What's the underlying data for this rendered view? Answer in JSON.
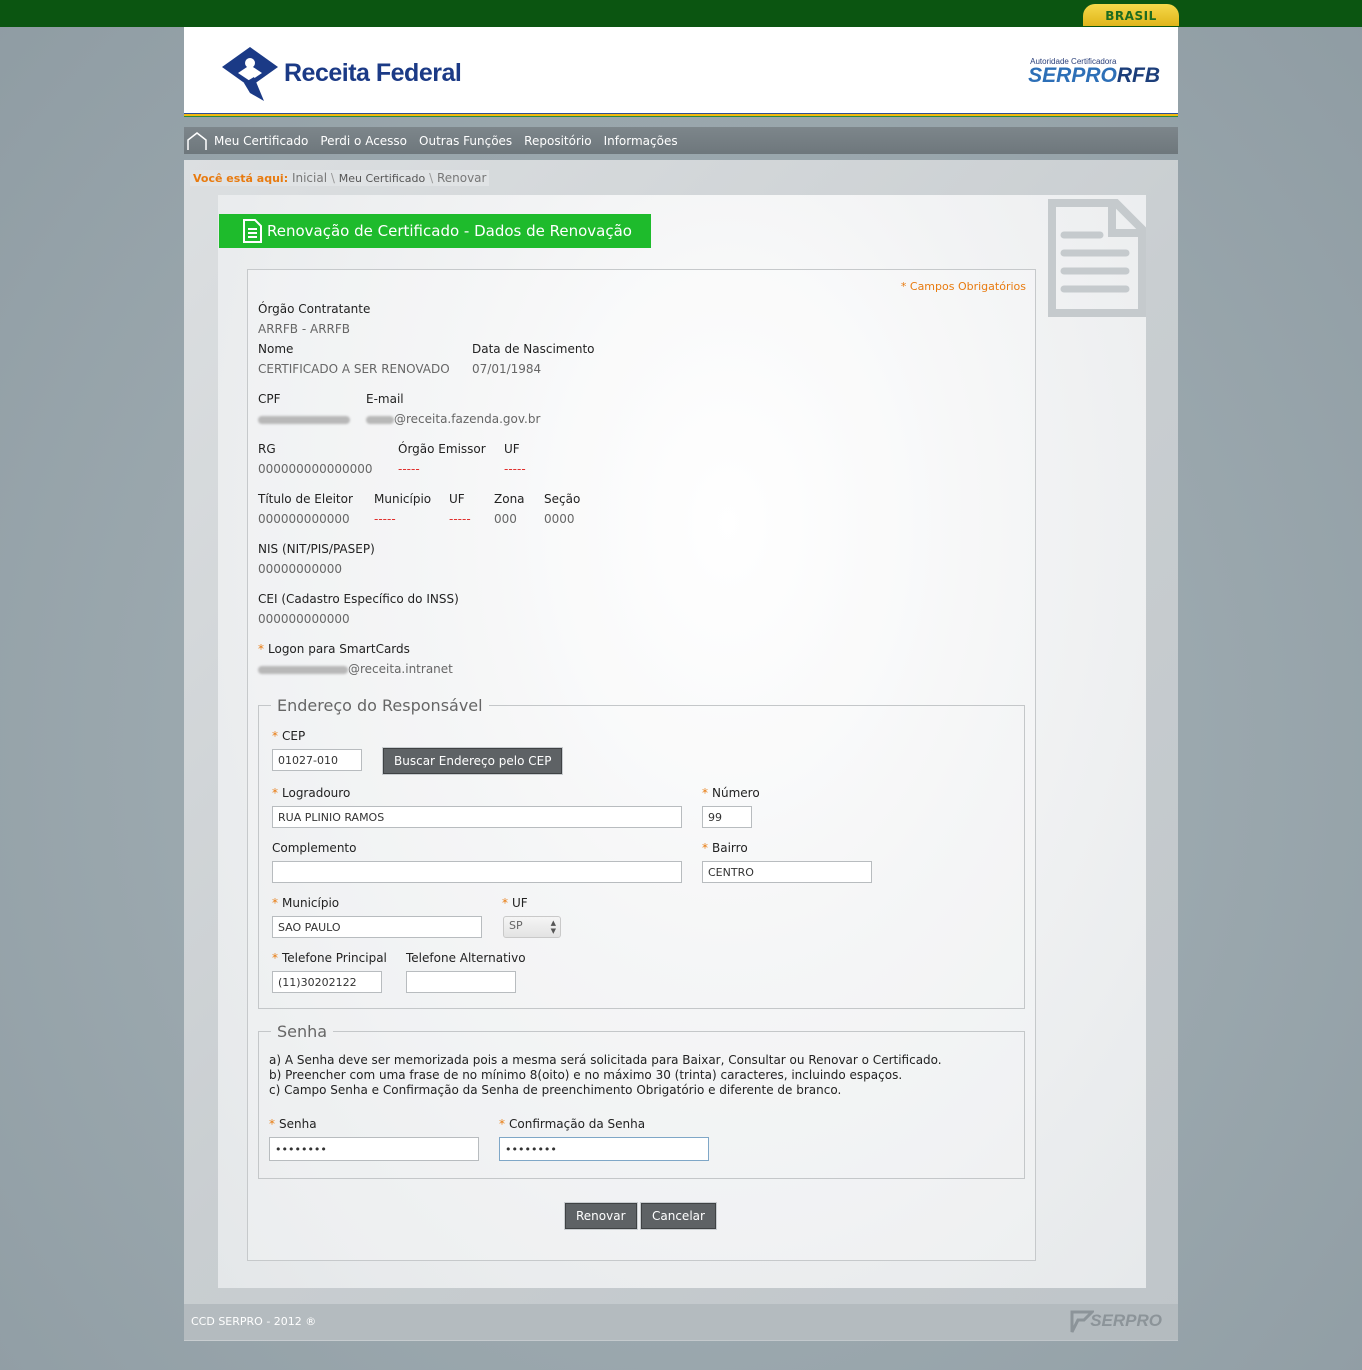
{
  "gov_bar": {
    "brasil_label": "BRASIL"
  },
  "header": {
    "logo_text": "Receita Federal",
    "serpro_sub": "Autoridade Certificadora",
    "serpro_main": "SERPRO",
    "serpro_rfb": "RFB"
  },
  "nav": {
    "items": [
      {
        "label": "Meu Certificado"
      },
      {
        "label": "Perdi o Acesso"
      },
      {
        "label": "Outras Funções"
      },
      {
        "label": "Repositório"
      },
      {
        "label": "Informações"
      }
    ]
  },
  "breadcrumb": {
    "prefix": "Você está aqui:",
    "items": [
      "Inicial",
      "Meu Certificado",
      "Renovar"
    ]
  },
  "page_title": "Renovação de Certificado - Dados de Renovação",
  "required_note": "* Campos Obrigatórios",
  "fields": {
    "orgao_label": "Órgão Contratante",
    "orgao_value": "ARRFB - ARRFB",
    "nome_label": "Nome",
    "nome_value": "CERTIFICADO A SER RENOVADO",
    "nasc_label": "Data de Nascimento",
    "nasc_value": "07/01/1984",
    "cpf_label": "CPF",
    "email_label": "E-mail",
    "email_value": "@receita.fazenda.gov.br",
    "rg_label": "RG",
    "rg_value": "000000000000000",
    "orgao_emissor_label": "Órgão Emissor",
    "orgao_emissor_value": "-----",
    "uf_label": "UF",
    "uf_value": "-----",
    "titulo_label": "Título de Eleitor",
    "titulo_value": "000000000000",
    "municipio_label": "Município",
    "municipio_value": "-----",
    "uf2_label": "UF",
    "uf2_value": "-----",
    "zona_label": "Zona",
    "zona_value": "000",
    "secao_label": "Seção",
    "secao_value": "0000",
    "nis_label": "NIS (NIT/PIS/PASEP)",
    "nis_value": "00000000000",
    "cei_label": "CEI (Cadastro Específico do INSS)",
    "cei_value": "000000000000",
    "logon_label": "Logon para SmartCards",
    "logon_value": "@receita.intranet"
  },
  "address": {
    "legend": "Endereço do Responsável",
    "cep_label": "CEP",
    "cep_value": "01027-010",
    "buscar_button": "Buscar Endereço pelo CEP",
    "logradouro_label": "Logradouro",
    "logradouro_value": "RUA PLINIO RAMOS",
    "numero_label": "Número",
    "numero_value": "99",
    "complemento_label": "Complemento",
    "complemento_value": "",
    "bairro_label": "Bairro",
    "bairro_value": "CENTRO",
    "municipio_label": "Município",
    "municipio_value": "SAO PAULO",
    "uf_label": "UF",
    "uf_value": "SP",
    "tel_principal_label": "Telefone Principal",
    "tel_principal_value": "(11)30202122",
    "tel_alternativo_label": "Telefone Alternativo",
    "tel_alternativo_value": ""
  },
  "senha": {
    "legend": "Senha",
    "instructions": [
      "a) A Senha deve ser memorizada pois a mesma será solicitada para Baixar, Consultar ou Renovar o Certificado.",
      "b) Preencher com uma frase de no mínimo 8(oito) e no máximo 30 (trinta) caracteres, incluindo espaços.",
      "c) Campo Senha e Confirmação da Senha de preenchimento Obrigatório e diferente de branco."
    ],
    "senha_label": "Senha",
    "senha_value": "12345678",
    "confirmacao_label": "Confirmação da Senha",
    "confirmacao_value": "12345678"
  },
  "actions": {
    "renovar": "Renovar",
    "cancelar": "Cancelar"
  },
  "footer": {
    "text": "CCD SERPRO - 2012 ®",
    "logo": "SERPRO"
  },
  "colors": {
    "gov_green": "#0b5511",
    "title_green": "#1ebb2c",
    "accent_orange": "#e87b10",
    "nav_gray": "#747d82",
    "button_gray": "#5e6265",
    "error_red": "#e0302e"
  },
  "icons": [
    "home-icon",
    "document-icon",
    "serpro-logo-icon",
    "receita-federal-logo-icon"
  ]
}
